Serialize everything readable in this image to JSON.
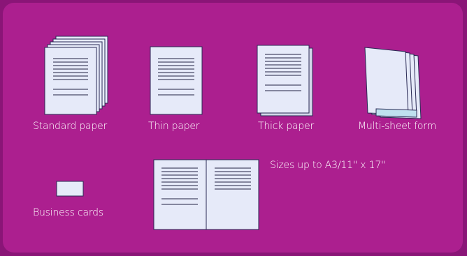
{
  "colors": {
    "background": "#ac1f8f",
    "frame": "#8a1577",
    "paper": "#e6eaf9",
    "paper_edge": "#2a2a55",
    "text_lines": "#222244",
    "label_text": "#ffffff"
  },
  "items": [
    {
      "label": "Standard paper",
      "icon": "stacked-paper-icon"
    },
    {
      "label": "Thin paper",
      "icon": "single-sheet-icon"
    },
    {
      "label": "Thick paper",
      "icon": "thick-paper-icon"
    },
    {
      "label": "Multi-sheet form",
      "icon": "multi-sheet-form-icon"
    },
    {
      "label": "Business cards",
      "icon": "business-card-icon"
    }
  ],
  "sizes_note": "Sizes up to A3/11\" x 17\"",
  "sizes_icon": "open-document-icon"
}
